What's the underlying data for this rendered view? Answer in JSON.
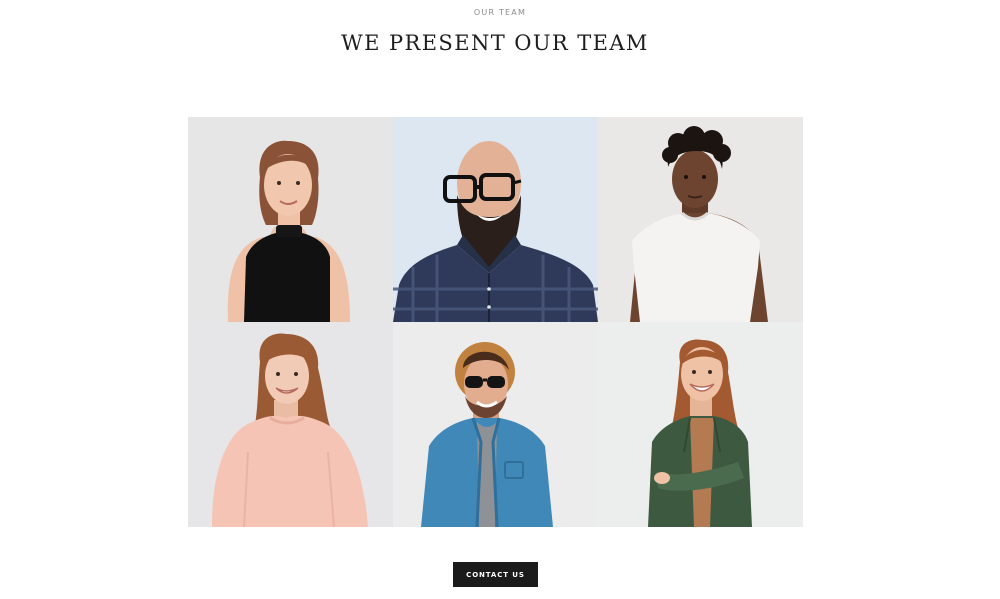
{
  "header": {
    "eyebrow": "OUR TEAM",
    "title": "WE PRESENT OUR TEAM"
  },
  "team": [
    {
      "photo": "woman-black-top-photo",
      "background": "#e6e6e6",
      "skin": "#f1c7ae",
      "hair": "#8a5338",
      "top": "#111111"
    },
    {
      "photo": "bald-man-glasses-beard-photo",
      "background": "#dde7f1",
      "skin": "#e3b296",
      "hair": "#2a1f1a",
      "top": "#2f3a5a"
    },
    {
      "photo": "man-white-tshirt-photo",
      "background": "#e9e8e6",
      "skin": "#6d4430",
      "hair": "#1b1410",
      "top": "#f4f3f1"
    },
    {
      "photo": "woman-pink-sweater-photo",
      "background": "#e6e5e8",
      "skin": "#f1cbb5",
      "hair": "#9a5a34",
      "top": "#f6c4b4"
    },
    {
      "photo": "man-hat-sunglasses-denim-photo",
      "background": "#ececec",
      "skin": "#e2ad8e",
      "hair": "#4a2c1d",
      "top": "#3f88b8"
    },
    {
      "photo": "woman-green-shirt-photo",
      "background": "#eceeee",
      "skin": "#efc2a6",
      "hair": "#a45a30",
      "top": "#3d5a40"
    }
  ],
  "cta": {
    "label": "CONTACT US"
  }
}
